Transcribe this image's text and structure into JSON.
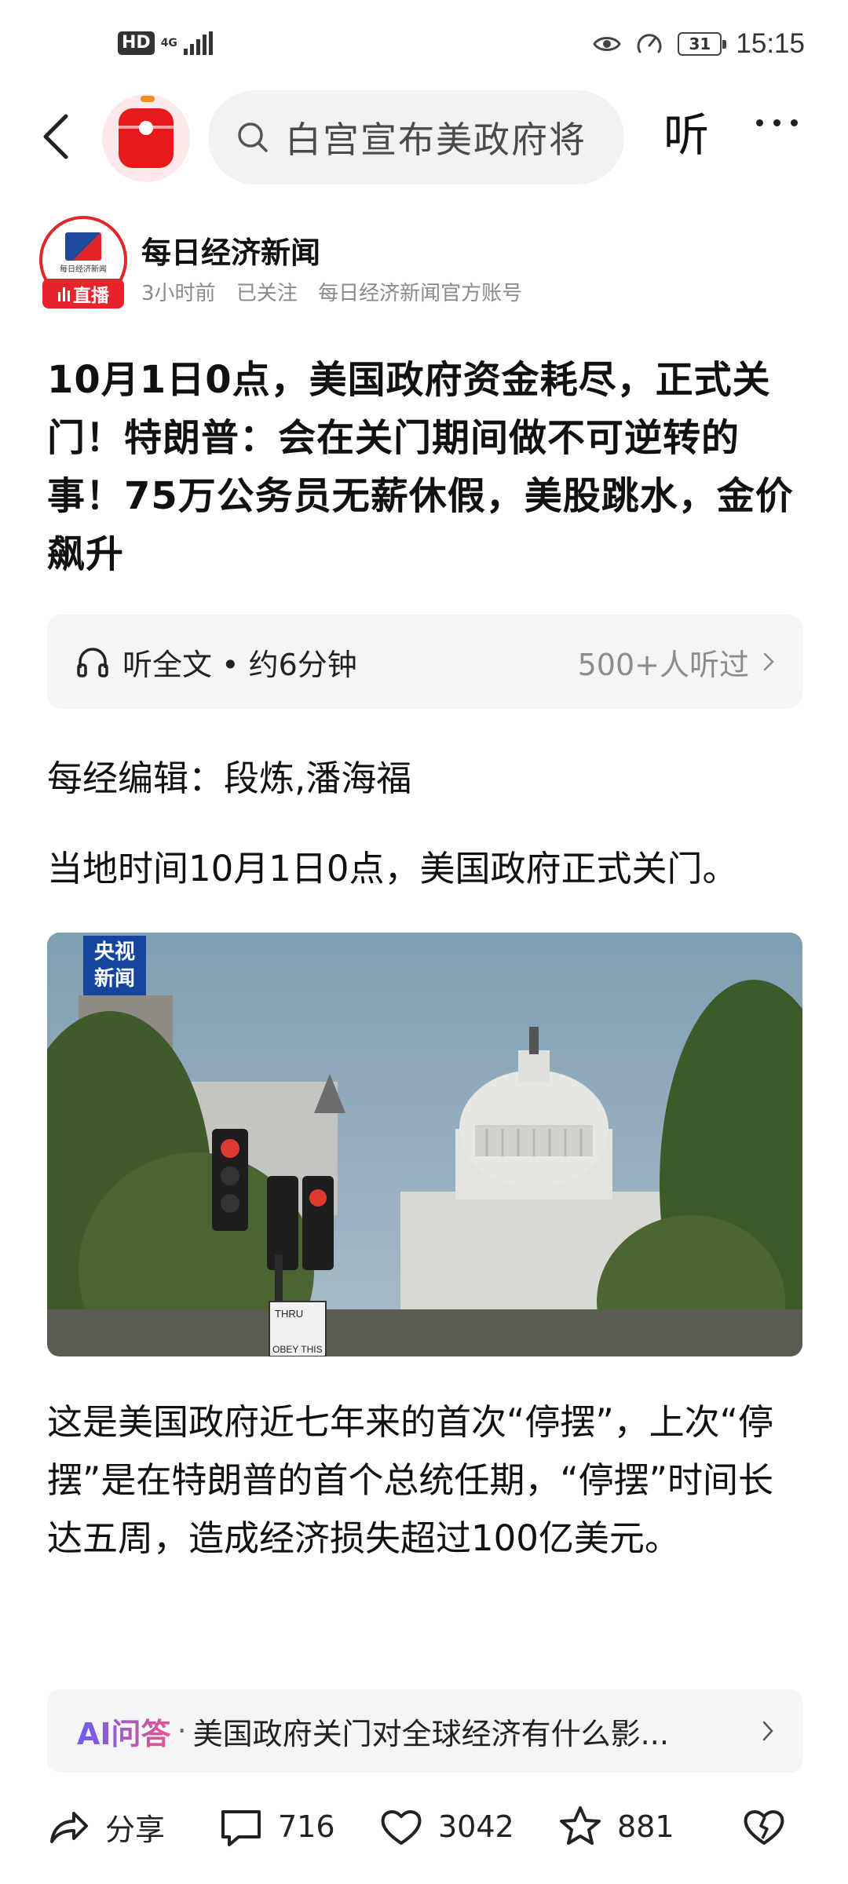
{
  "status_bar": {
    "hd_label": "HD",
    "network_label": "4G",
    "time": "15:15",
    "battery_level": "31",
    "icons": [
      "eye-icon",
      "speed-icon",
      "battery-icon",
      "signal-icon"
    ]
  },
  "nav": {
    "search_text": "白宫宣布美政府将",
    "listen_label": "听",
    "icons": [
      "back-icon",
      "app-icon",
      "search-icon",
      "more-icon"
    ]
  },
  "author": {
    "name": "每日经济新闻",
    "avatar_brand": "每日经济新闻",
    "live_badge": "直播",
    "time_ago": "3小时前",
    "follow_status": "已关注",
    "account_desc": "每日经济新闻官方账号"
  },
  "article": {
    "headline": "10月1日0点，美国政府资金耗尽，正式关门！特朗普：会在关门期间做不可逆转的事！75万公务员无薪休假，美股跳水，金价飙升",
    "listen_card": {
      "label": "听全文 • 约6分钟",
      "count": "500+人听过"
    },
    "editor_line": "每经编辑：段炼,潘海福",
    "lead": "当地时间10月1日0点，美国政府正式关门。",
    "image": {
      "watermark_line1": "央视",
      "watermark_line2": "新闻",
      "sign_line1": "THRU",
      "sign_line2": "OBEY THIS"
    },
    "paragraph": "这是美国政府近七年来的首次“停摆”，上次“停摆”是在特朗普的首个总统任期，“停摆”时间长达五周，造成经济损失超过100亿美元。"
  },
  "ai_bar": {
    "tag": "AI问答",
    "separator": "·",
    "question": "美国政府关门对全球经济有什么影..."
  },
  "toolbar": {
    "share_label": "分享",
    "comment_count": "716",
    "like_count": "3042",
    "favorite_count": "881"
  },
  "colors": {
    "accent_red": "#e8232b",
    "brand_blue": "#1d4a9a",
    "ai_gradient_start": "#6d5cf2",
    "ai_gradient_end": "#e2588e"
  }
}
